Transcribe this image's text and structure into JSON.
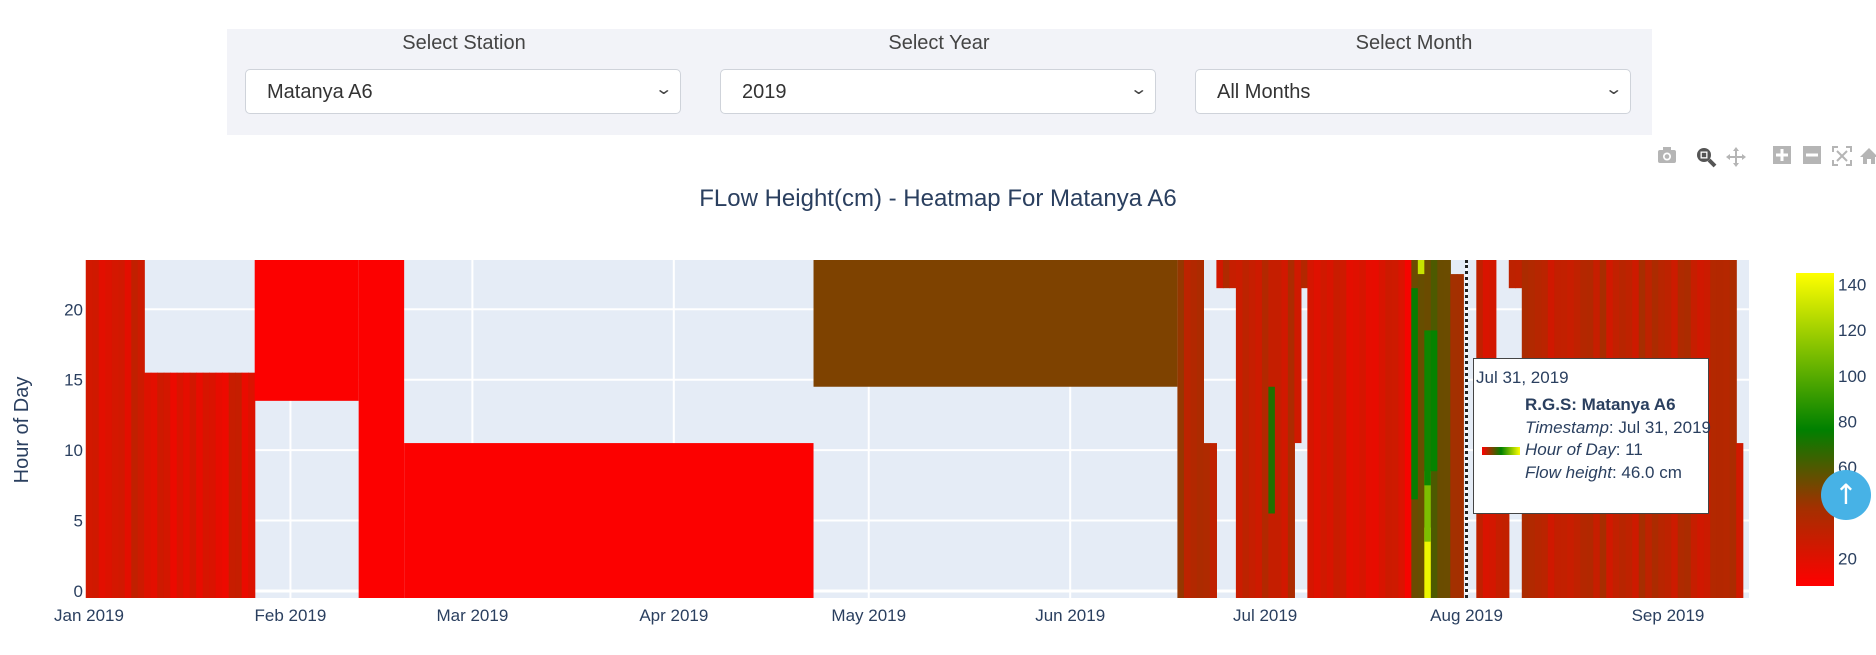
{
  "filters": [
    {
      "label": "Select Station",
      "value": "Matanya A6"
    },
    {
      "label": "Select Year",
      "value": "2019"
    },
    {
      "label": "Select Month",
      "value": "All Months"
    }
  ],
  "modebar": {
    "buttons": [
      {
        "name": "camera-icon",
        "glyph": "📷",
        "tooltip": "Download plot as png"
      },
      {
        "name": "zoom-icon",
        "glyph": "🔍",
        "tooltip": "Zoom"
      },
      {
        "name": "pan-icon",
        "glyph": "✥",
        "tooltip": "Pan"
      },
      {
        "name": "zoom-in-icon",
        "glyph": "+",
        "tooltip": "Zoom in"
      },
      {
        "name": "zoom-out-icon",
        "glyph": "−",
        "tooltip": "Zoom out"
      },
      {
        "name": "autoscale-icon",
        "glyph": "⤢",
        "tooltip": "Autoscale"
      },
      {
        "name": "home-icon",
        "glyph": "⌂",
        "tooltip": "Reset axes"
      }
    ]
  },
  "tooltip": {
    "header": "Jul 31, 2019",
    "station_line": "R.G.S: Matanya A6",
    "timestamp_label": "Timestamp",
    "timestamp_value": ": Jul 31, 2019",
    "hour_label": "Hour of Day",
    "hour_value": ": 11",
    "flow_label": "Flow height",
    "flow_value": ": 46.0 cm"
  },
  "scroll_top_glyph": "↑",
  "chart_data": {
    "type": "heatmap",
    "title": "FLow Height(cm) - Heatmap For Matanya A6",
    "xlabel": "",
    "ylabel": "Hour of Day",
    "x_range": [
      "2019-01-01",
      "2019-09-12"
    ],
    "y_range": [
      -0.5,
      23.5
    ],
    "x_ticks": [
      "Jan 2019",
      "Feb 2019",
      "Mar 2019",
      "Apr 2019",
      "May 2019",
      "Jun 2019",
      "Jul 2019",
      "Aug 2019",
      "Sep 2019"
    ],
    "x_tick_dates": [
      "2019-01-01",
      "2019-02-01",
      "2019-03-01",
      "2019-04-01",
      "2019-05-01",
      "2019-06-01",
      "2019-07-01",
      "2019-08-01",
      "2019-09-01"
    ],
    "y_ticks": [
      0,
      5,
      10,
      15,
      20
    ],
    "colorbar": {
      "min": 8,
      "max": 145,
      "ticks": [
        20,
        60,
        80,
        100,
        120,
        140
      ],
      "colorscale": [
        [
          0,
          "#ff0000"
        ],
        [
          0.5,
          "#008000"
        ],
        [
          1,
          "#ffff00"
        ]
      ]
    },
    "grid": true,
    "blocks": [
      {
        "start": "2019-01-01",
        "end": "2019-01-10",
        "hour_from": 0,
        "hour_to": 23,
        "value": 25
      },
      {
        "start": "2019-01-10",
        "end": "2019-01-27",
        "hour_from": 0,
        "hour_to": 15,
        "value": 22
      },
      {
        "start": "2019-01-27",
        "end": "2019-02-12",
        "hour_from": 14,
        "hour_to": 23,
        "value": 9
      },
      {
        "start": "2019-02-12",
        "end": "2019-02-19",
        "hour_from": 0,
        "hour_to": 23,
        "value": 9
      },
      {
        "start": "2019-02-19",
        "end": "2019-04-23",
        "hour_from": 0,
        "hour_to": 10,
        "value": 9
      },
      {
        "start": "2019-04-23",
        "end": "2019-06-18",
        "hour_from": 15,
        "hour_to": 23,
        "value": 50
      },
      {
        "start": "2019-06-18",
        "end": "2019-06-22",
        "hour_from": 0,
        "hour_to": 23,
        "value": 38
      },
      {
        "start": "2019-06-22",
        "end": "2019-06-24",
        "hour_from": 0,
        "hour_to": 10,
        "value": 35
      },
      {
        "start": "2019-06-24",
        "end": "2019-06-27",
        "hour_from": 22,
        "hour_to": 23,
        "value": 30
      },
      {
        "start": "2019-06-27",
        "end": "2019-07-06",
        "hour_from": 0,
        "hour_to": 23,
        "value": 32
      },
      {
        "start": "2019-07-06",
        "end": "2019-07-07",
        "hour_from": 11,
        "hour_to": 23,
        "value": 30
      },
      {
        "start": "2019-07-07",
        "end": "2019-07-08",
        "hour_from": 22,
        "hour_to": 23,
        "value": 30
      },
      {
        "start": "2019-07-08",
        "end": "2019-07-22",
        "hour_from": 0,
        "hour_to": 23,
        "value": 24
      },
      {
        "start": "2019-07-22",
        "end": "2019-07-24",
        "hour_from": 0,
        "hour_to": 23,
        "value": 14
      },
      {
        "start": "2019-07-24",
        "end": "2019-07-30",
        "hour_from": 0,
        "hour_to": 23,
        "value": 55
      },
      {
        "start": "2019-07-30",
        "end": "2019-08-01",
        "hour_from": 0,
        "hour_to": 22,
        "value": 46
      },
      {
        "start": "2019-08-03",
        "end": "2019-08-06",
        "hour_from": 0,
        "hour_to": 23,
        "value": 28
      },
      {
        "start": "2019-08-06",
        "end": "2019-08-08",
        "hour_from": 0,
        "hour_to": 11,
        "value": 25
      },
      {
        "start": "2019-08-08",
        "end": "2019-08-10",
        "hour_from": 22,
        "hour_to": 23,
        "value": 25
      },
      {
        "start": "2019-08-10",
        "end": "2019-09-12",
        "hour_from": 0,
        "hour_to": 23,
        "value": 33
      },
      {
        "start": "2019-09-12",
        "end": "2019-09-13",
        "hour_from": 0,
        "hour_to": 10,
        "value": 30
      }
    ],
    "highlight_cells": [
      {
        "date": "2019-07-26",
        "hour_from": 0,
        "hour_to": 4,
        "value": 140
      },
      {
        "date": "2019-07-26",
        "hour_from": 4,
        "hour_to": 8,
        "value": 110
      },
      {
        "date": "2019-07-26",
        "hour_from": 8,
        "hour_to": 18,
        "value": 80
      },
      {
        "date": "2019-07-25",
        "hour_from": 23,
        "hour_to": 23,
        "value": 130
      },
      {
        "date": "2019-07-24",
        "hour_from": 7,
        "hour_to": 21,
        "value": 75
      },
      {
        "date": "2019-07-27",
        "hour_from": 9,
        "hour_to": 18,
        "value": 78
      },
      {
        "date": "2019-07-02",
        "hour_from": 6,
        "hour_to": 14,
        "value": 70
      }
    ],
    "hover_point": {
      "date": "2019-07-31",
      "hour": 11,
      "value": 46.0
    }
  }
}
